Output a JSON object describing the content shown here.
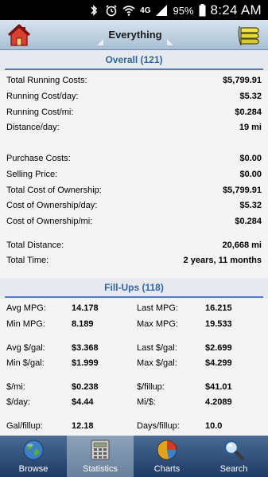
{
  "status_bar": {
    "network": "4G",
    "battery": "95%",
    "time": "8:24 AM",
    "icons": [
      "bluetooth-icon",
      "alarm-icon",
      "wifi-icon",
      "signal-icon",
      "battery-icon"
    ]
  },
  "toolbar": {
    "title": "Everything",
    "home_icon": "home-icon",
    "menu_icon": "menu-stack-icon"
  },
  "overall": {
    "header": "Overall (121)",
    "rows": [
      {
        "label": "Total Running Costs:",
        "value": "$5,799.91"
      },
      {
        "label": "Running Cost/day:",
        "value": "$5.32"
      },
      {
        "label": "Running Cost/mi:",
        "value": "$0.284"
      },
      {
        "label": "Distance/day:",
        "value": "19 mi"
      },
      {
        "label": "Purchase Costs:",
        "value": "$0.00"
      },
      {
        "label": "Selling Price:",
        "value": "$0.00"
      },
      {
        "label": "Total Cost of Ownership:",
        "value": "$5,799.91"
      },
      {
        "label": "Cost of Ownership/day:",
        "value": "$5.32"
      },
      {
        "label": "Cost of Ownership/mi:",
        "value": "$0.284"
      },
      {
        "label": "Total Distance:",
        "value": "20,668 mi"
      },
      {
        "label": "Total Time:",
        "value": "2 years, 11 months"
      }
    ]
  },
  "fillups": {
    "header": "Fill-Ups (118)",
    "rows": [
      [
        {
          "label": "Avg MPG:",
          "value": "14.178"
        },
        {
          "label": "Last MPG:",
          "value": "16.215"
        }
      ],
      [
        {
          "label": "Min MPG:",
          "value": "8.189"
        },
        {
          "label": "Max MPG:",
          "value": "19.533"
        }
      ],
      [
        {
          "label": "Avg $/gal:",
          "value": "$3.368"
        },
        {
          "label": "Last $/gal:",
          "value": "$2.699"
        }
      ],
      [
        {
          "label": "Min $/gal:",
          "value": "$1.999"
        },
        {
          "label": "Max $/gal:",
          "value": "$4.299"
        }
      ],
      [
        {
          "label": "$/mi:",
          "value": "$0.238"
        },
        {
          "label": "$/fillup:",
          "value": "$41.01"
        }
      ],
      [
        {
          "label": "$/day:",
          "value": "$4.44"
        },
        {
          "label": "Mi/$:",
          "value": "4.2089"
        }
      ],
      [
        {
          "label": "Gal/fillup:",
          "value": "12.18"
        },
        {
          "label": "Days/fillup:",
          "value": "10.0"
        }
      ]
    ]
  },
  "tabs": [
    {
      "label": "Browse",
      "icon": "globe-icon"
    },
    {
      "label": "Statistics",
      "icon": "calculator-icon"
    },
    {
      "label": "Charts",
      "icon": "pie-chart-icon"
    },
    {
      "label": "Search",
      "icon": "magnifier-icon"
    }
  ],
  "active_tab": "Statistics"
}
